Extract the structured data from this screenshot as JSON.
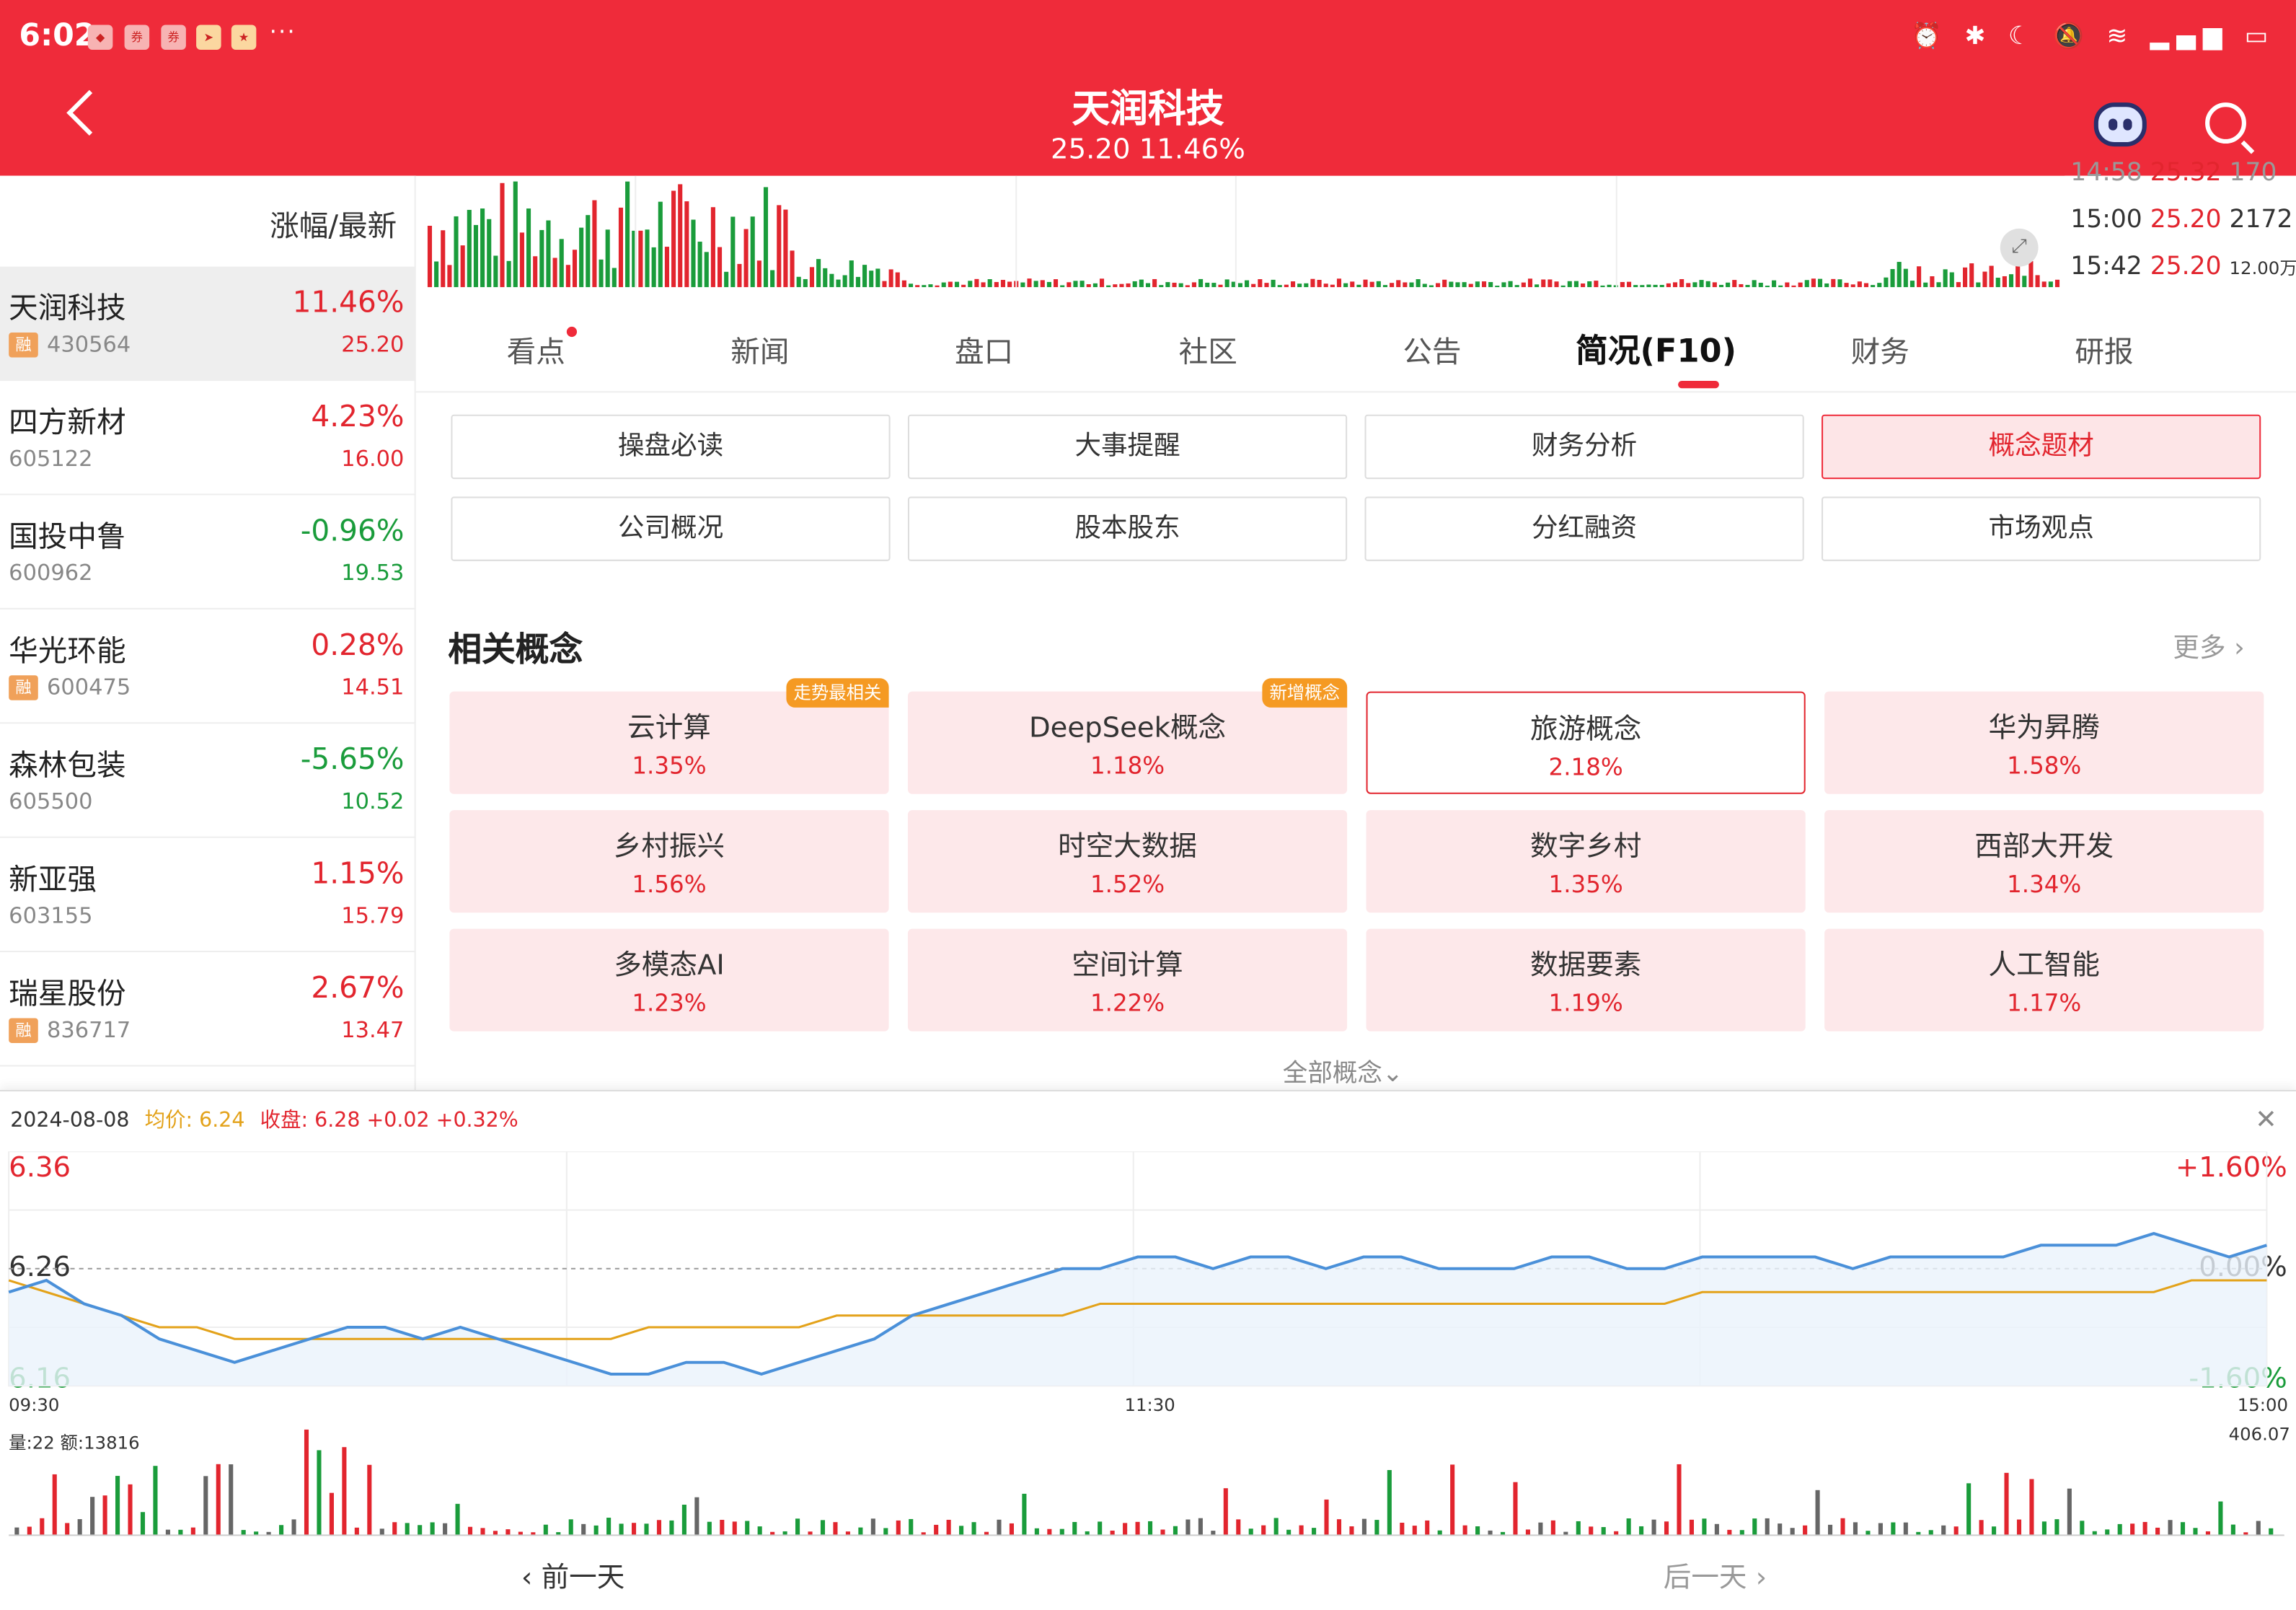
{
  "status_bar": {
    "time": "6:02",
    "dots": "···"
  },
  "header": {
    "title": "天润科技",
    "subtitle": "25.20 11.46%"
  },
  "list": {
    "header": "涨幅/最新",
    "rong_label": "融",
    "items": [
      {
        "name": "天润科技",
        "code": "430564",
        "rong": true,
        "pct": "11.46%",
        "price": "25.20",
        "dir": "up",
        "active": true
      },
      {
        "name": "四方新材",
        "code": "605122",
        "rong": false,
        "pct": "4.23%",
        "price": "16.00",
        "dir": "up"
      },
      {
        "name": "国投中鲁",
        "code": "600962",
        "rong": false,
        "pct": "-0.96%",
        "price": "19.53",
        "dir": "down"
      },
      {
        "name": "华光环能",
        "code": "600475",
        "rong": true,
        "pct": "0.28%",
        "price": "14.51",
        "dir": "up"
      },
      {
        "name": "森林包装",
        "code": "605500",
        "rong": false,
        "pct": "-5.65%",
        "price": "10.52",
        "dir": "down"
      },
      {
        "name": "新亚强",
        "code": "603155",
        "rong": false,
        "pct": "1.15%",
        "price": "15.79",
        "dir": "up"
      },
      {
        "name": "瑞星股份",
        "code": "836717",
        "rong": true,
        "pct": "2.67%",
        "price": "13.47",
        "dir": "up"
      }
    ]
  },
  "ticks": [
    {
      "time": "15:00",
      "price": "25.20",
      "vol": "2172"
    },
    {
      "time": "15:42",
      "price": "25.20",
      "vol": "12.00万"
    }
  ],
  "tabs": [
    "看点",
    "新闻",
    "盘口",
    "社区",
    "公告",
    "简况(F10)",
    "财务",
    "研报"
  ],
  "func_buttons": [
    "操盘必读",
    "大事提醒",
    "财务分析",
    "概念题材",
    "公司概况",
    "股本股东",
    "分红融资",
    "市场观点"
  ],
  "concepts": {
    "title": "相关概念",
    "more": "更多",
    "all": "全部概念",
    "items": [
      {
        "name": "云计算",
        "pct": "1.35%",
        "badge": "走势最相关"
      },
      {
        "name": "DeepSeek概念",
        "pct": "1.18%",
        "badge": "新增概念"
      },
      {
        "name": "旅游概念",
        "pct": "2.18%",
        "selected": true
      },
      {
        "name": "华为昇腾",
        "pct": "1.58%"
      },
      {
        "name": "乡村振兴",
        "pct": "1.56%"
      },
      {
        "name": "时空大数据",
        "pct": "1.52%"
      },
      {
        "name": "数字乡村",
        "pct": "1.35%"
      },
      {
        "name": "西部大开发",
        "pct": "1.34%"
      },
      {
        "name": "多模态AI",
        "pct": "1.23%"
      },
      {
        "name": "空间计算",
        "pct": "1.22%"
      },
      {
        "name": "数据要素",
        "pct": "1.19%"
      },
      {
        "name": "人工智能",
        "pct": "1.17%"
      }
    ]
  },
  "intraday": {
    "date": "2024-08-08",
    "avg_label": "均价: 6.24",
    "close_label": "收盘: 6.28 +0.02 +0.32%",
    "y_max": "6.36",
    "y_mid": "6.26",
    "y_min": "6.16",
    "pct_max": "+1.60%",
    "pct_mid": "0.00%",
    "pct_min": "-1.60%",
    "t_start": "09:30",
    "t_mid": "11:30",
    "t_end": "15:00",
    "vol_label": "量:22  额:13816",
    "vol_max": "406.07",
    "prev": "前一天",
    "next": "后一天"
  },
  "colors": {
    "brand": "#ef2b3a",
    "up": "#e2252e",
    "down": "#1a9c3b",
    "price_line": "#4a90d9",
    "avg_line": "#e3a21a"
  },
  "chart_data": {
    "type": "line",
    "title": "",
    "x_labels": [
      "09:30",
      "11:30",
      "15:00"
    ],
    "ylim": [
      6.16,
      6.36
    ],
    "series": [
      {
        "values": [
          6.24,
          6.25,
          6.23,
          6.22,
          6.2,
          6.19,
          6.18,
          6.19,
          6.2,
          6.21,
          6.21,
          6.2,
          6.21,
          6.2,
          6.19,
          6.18,
          6.17,
          6.17,
          6.18,
          6.18,
          6.17,
          6.18,
          6.19,
          6.2,
          6.22,
          6.23,
          6.24,
          6.25,
          6.26,
          6.26,
          6.27,
          6.27,
          6.26,
          6.27,
          6.27,
          6.26,
          6.27,
          6.27,
          6.26,
          6.26,
          6.26,
          6.27,
          6.27,
          6.26,
          6.26,
          6.27,
          6.27,
          6.27,
          6.27,
          6.26,
          6.27,
          6.27,
          6.27,
          6.27,
          6.28,
          6.28,
          6.28,
          6.29,
          6.28,
          6.27,
          6.28
        ]
      },
      {
        "values": [
          6.25,
          6.24,
          6.23,
          6.22,
          6.21,
          6.21,
          6.2,
          6.2,
          6.2,
          6.2,
          6.2,
          6.2,
          6.2,
          6.2,
          6.2,
          6.2,
          6.2,
          6.21,
          6.21,
          6.21,
          6.21,
          6.21,
          6.22,
          6.22,
          6.22,
          6.22,
          6.22,
          6.22,
          6.22,
          6.23,
          6.23,
          6.23,
          6.23,
          6.23,
          6.23,
          6.23,
          6.23,
          6.23,
          6.23,
          6.23,
          6.23,
          6.23,
          6.23,
          6.23,
          6.23,
          6.24,
          6.24,
          6.24,
          6.24,
          6.24,
          6.24,
          6.24,
          6.24,
          6.24,
          6.24,
          6.24,
          6.24,
          6.24,
          6.25,
          6.25,
          6.25
        ]
      }
    ]
  }
}
